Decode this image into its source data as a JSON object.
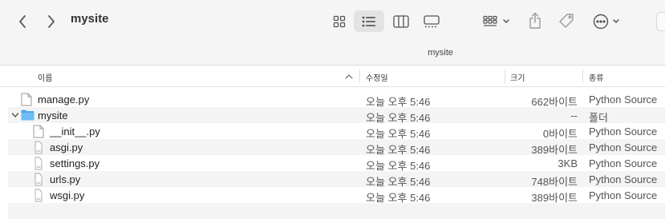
{
  "window": {
    "title": "mysite",
    "path_label": "mysite"
  },
  "toolbar": {
    "back_icon": "chevron-left-icon",
    "forward_icon": "chevron-right-icon",
    "views": [
      "grid-view-icon",
      "list-view-icon",
      "columns-view-icon",
      "gallery-view-icon"
    ],
    "selected_view": "list-view-icon",
    "group_icon": "group-by-icon",
    "share_icon": "share-icon",
    "tag_icon": "tag-icon",
    "more_icon": "more-actions-icon"
  },
  "columns": {
    "name": "이름",
    "modified": "수정일",
    "size": "크기",
    "kind": "종류"
  },
  "files": [
    {
      "name": "manage.py",
      "type": "file",
      "indent": 0,
      "modified": "오늘 오후 5:46",
      "size": "662바이트",
      "kind": "Python Source"
    },
    {
      "name": "mysite",
      "type": "folder",
      "indent": 0,
      "expanded": true,
      "modified": "오늘 오후 5:46",
      "size": "--",
      "kind": "폴더"
    },
    {
      "name": "__init__.py",
      "type": "file",
      "indent": 1,
      "modified": "오늘 오후 5:46",
      "size": "0바이트",
      "kind": "Python Source"
    },
    {
      "name": "asgi.py",
      "type": "file",
      "indent": 1,
      "modified": "오늘 오후 5:46",
      "size": "389바이트",
      "kind": "Python Source"
    },
    {
      "name": "settings.py",
      "type": "file",
      "indent": 1,
      "modified": "오늘 오후 5:46",
      "size": "3KB",
      "kind": "Python Source"
    },
    {
      "name": "urls.py",
      "type": "file",
      "indent": 1,
      "modified": "오늘 오후 5:46",
      "size": "748바이트",
      "kind": "Python Source"
    },
    {
      "name": "wsgi.py",
      "type": "file",
      "indent": 1,
      "modified": "오늘 오후 5:46",
      "size": "389바이트",
      "kind": "Python Source"
    }
  ],
  "colors": {
    "toolbar_bg": "#f6f5f5",
    "folder_blue": "#4aa8ec",
    "row_alt": "#f4f4f4"
  }
}
